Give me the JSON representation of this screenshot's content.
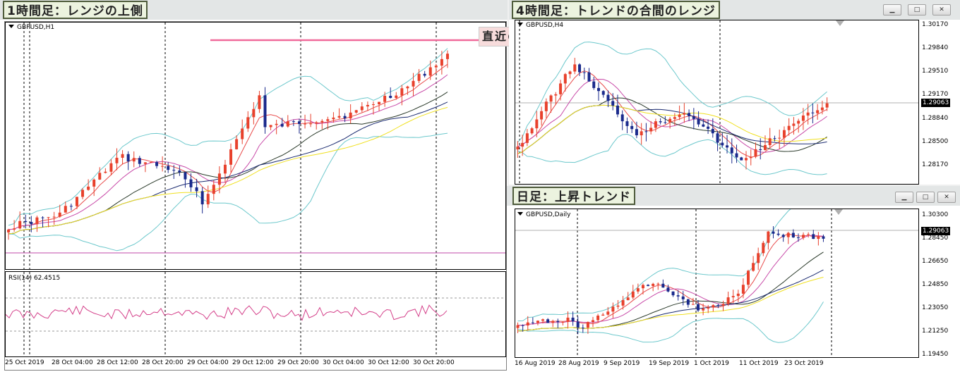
{
  "panels": {
    "h1": {
      "badge": "1時間足：レンジの上側",
      "symbol": "GBPUSD,H1",
      "rsi_label": "RSI(14) 62.4515",
      "annotation": "直近の高値",
      "x_labels": [
        "25 Oct 2019",
        "28 Oct 04:00",
        "28 Oct 12:00",
        "28 Oct 20:00",
        "29 Oct 04:00",
        "29 Oct 12:00",
        "29 Oct 20:00",
        "30 Oct 04:00",
        "30 Oct 12:00",
        "30 Oct 20:00"
      ]
    },
    "h4": {
      "badge": "4時間足：トレンドの合間のレンジ",
      "symbol": "GBPUSD,H4",
      "y_labels": [
        "1.30170",
        "1.29840",
        "1.29510",
        "1.29170",
        "1.28840",
        "1.28500",
        "1.28170"
      ],
      "current_price": "1.29063"
    },
    "daily": {
      "badge": "日足：上昇トレンド",
      "symbol": "GBPUSD,Daily",
      "y_labels": [
        "1.30300",
        "1.28450",
        "1.26650",
        "1.24850",
        "1.23050",
        "1.21250",
        "1.19450"
      ],
      "current_price": "1.29063",
      "x_labels": [
        "16 Aug 2019",
        "28 Aug 2019",
        "9 Sep 2019",
        "19 Sep 2019",
        "1 Oct 2019",
        "11 Oct 2019",
        "23 Oct 2019"
      ]
    }
  },
  "window_buttons": {
    "minimize": "▁",
    "maximize": "□",
    "close": "✕"
  },
  "colors": {
    "bull": "#e8412c",
    "bear": "#1a2a8c",
    "bb": "#6cc8cc",
    "ma_fast": "#e84a4a",
    "ma_mid": "#c84aa8",
    "ma_dark": "#2a3a2a",
    "ma_navy": "#1a2a70",
    "ma_yellow": "#f0e020",
    "rsi": "#d4408a",
    "high_line": "#f06a9a"
  },
  "chart_data": [
    {
      "type": "candlestick",
      "title": "GBPUSD,H1",
      "x_ticks": [
        "25 Oct 2019",
        "28 Oct 04:00",
        "28 Oct 12:00",
        "28 Oct 20:00",
        "29 Oct 04:00",
        "29 Oct 12:00",
        "29 Oct 20:00",
        "30 Oct 04:00",
        "30 Oct 12:00",
        "30 Oct 20:00"
      ],
      "annotations": [
        "直近の高値"
      ],
      "indicator": "RSI(14) 62.4515"
    },
    {
      "type": "candlestick",
      "title": "GBPUSD,H4",
      "y_ticks": [
        1.3017,
        1.2984,
        1.2951,
        1.2917,
        1.2884,
        1.285,
        1.2817
      ],
      "last": 1.29063
    },
    {
      "type": "candlestick",
      "title": "GBPUSD,Daily",
      "y_ticks": [
        1.303,
        1.2845,
        1.2665,
        1.2485,
        1.2305,
        1.2125,
        1.1945
      ],
      "x_ticks": [
        "16 Aug 2019",
        "28 Aug 2019",
        "9 Sep 2019",
        "19 Sep 2019",
        "1 Oct 2019",
        "11 Oct 2019",
        "23 Oct 2019"
      ],
      "last": 1.29063
    }
  ]
}
